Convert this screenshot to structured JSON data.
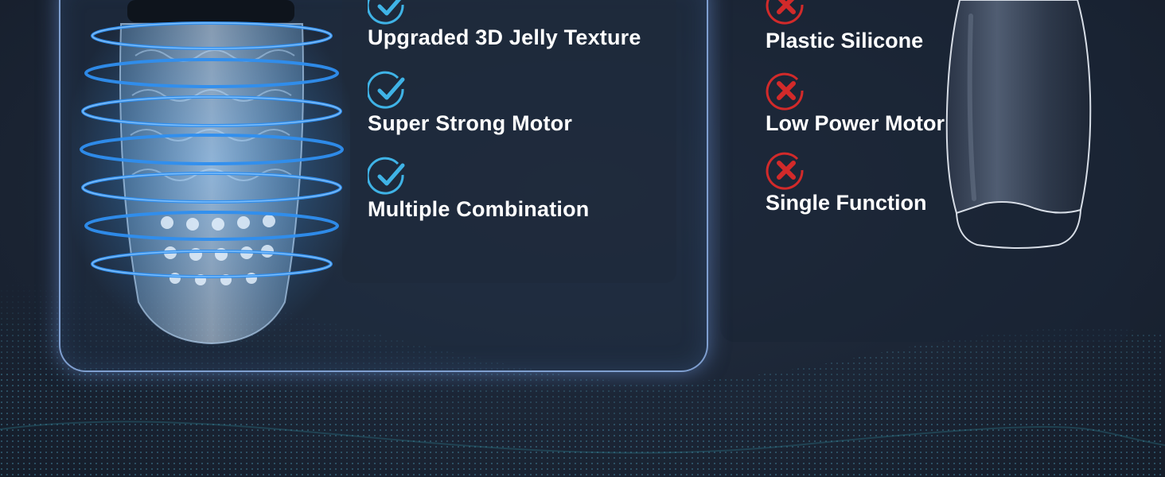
{
  "pros": [
    {
      "icon": "check-circle-icon",
      "label": "Upgraded 3D Jelly Texture"
    },
    {
      "icon": "check-circle-icon",
      "label": "Super Strong Motor"
    },
    {
      "icon": "check-circle-icon",
      "label": "Multiple Combination"
    }
  ],
  "cons": [
    {
      "icon": "x-circle-icon",
      "label": "Plastic Silicone"
    },
    {
      "icon": "x-circle-icon",
      "label": "Low Power Motor"
    },
    {
      "icon": "x-circle-icon",
      "label": "Single Function"
    }
  ],
  "colors": {
    "background": "#1c2636",
    "accent_blue": "#2f8ff0",
    "check_teal": "#3fb3e6",
    "cross_red": "#d22a2a",
    "card_border": "#7f9fd0",
    "text": "#ffffff"
  }
}
